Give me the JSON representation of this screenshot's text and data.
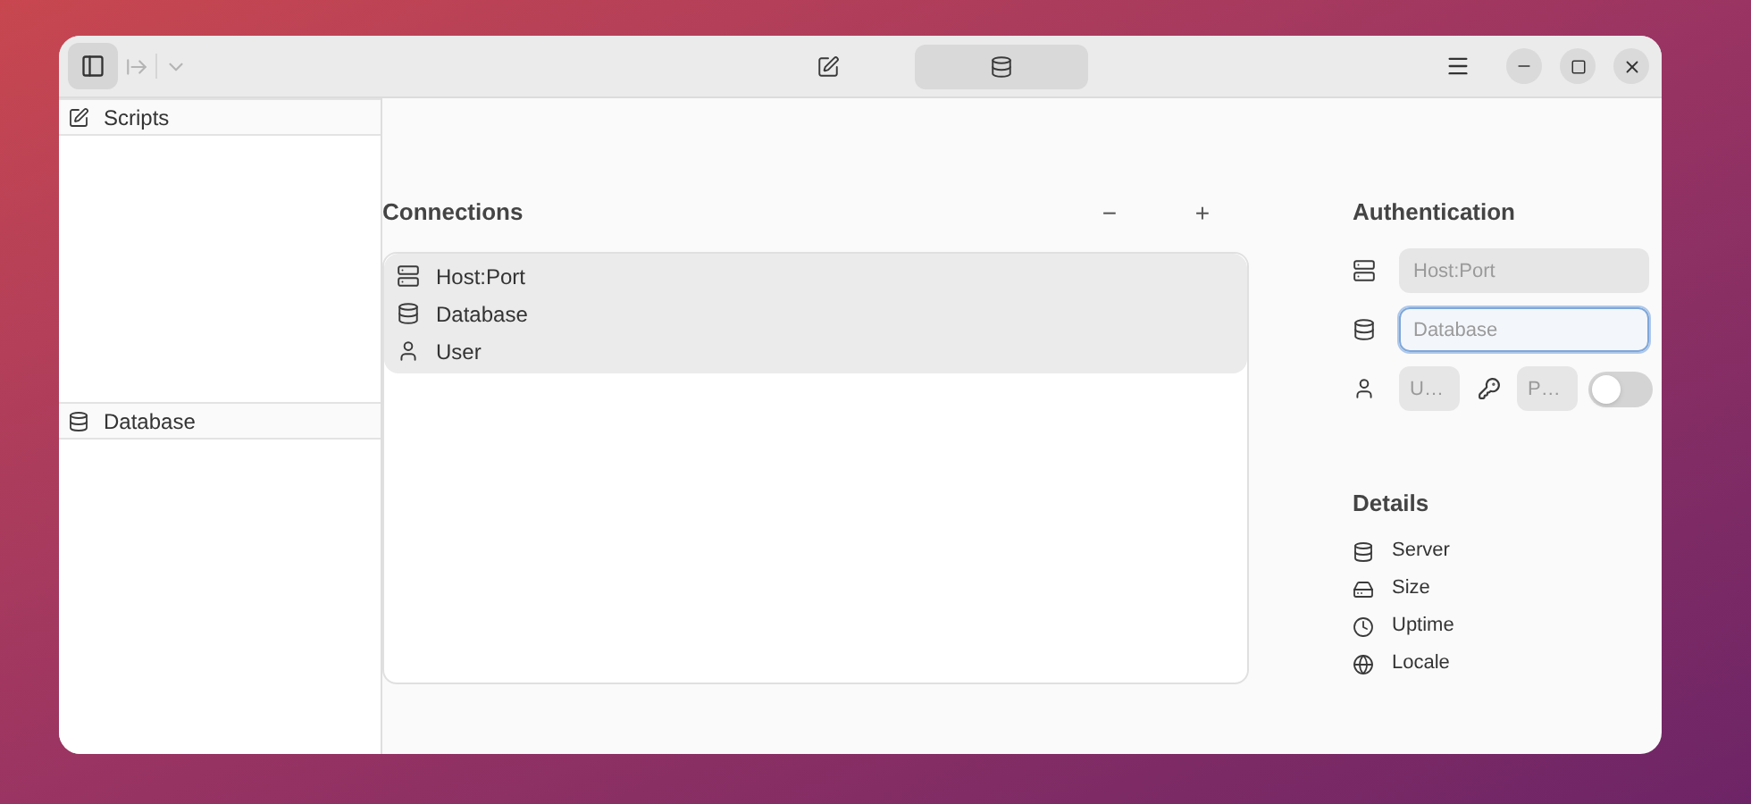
{
  "header": {
    "sidebar_toggle": {
      "selected": true
    },
    "view_tabs": [
      {
        "kind": "edit",
        "selected": false
      },
      {
        "kind": "database",
        "selected": true
      }
    ]
  },
  "sidebar": {
    "sections": [
      {
        "kind": "edit",
        "label": "Scripts"
      },
      {
        "kind": "database",
        "label": "Database"
      }
    ]
  },
  "connections": {
    "title": "Connections",
    "remove_label": "−",
    "add_label": "+",
    "items": [
      {
        "kind": "server",
        "label": "Host:Port"
      },
      {
        "kind": "database",
        "label": "Database"
      },
      {
        "kind": "user",
        "label": "User"
      }
    ]
  },
  "authentication": {
    "title": "Authentication",
    "fields": [
      {
        "kind": "server",
        "placeholder": "Host:Port",
        "focused": false
      },
      {
        "kind": "database",
        "placeholder": "Database",
        "focused": true
      }
    ],
    "user_placeholder": "U…",
    "password_placeholder": "P…",
    "toggle": {
      "on": false
    }
  },
  "details": {
    "title": "Details",
    "items": [
      {
        "kind": "database",
        "label": "Server"
      },
      {
        "kind": "disk",
        "label": "Size"
      },
      {
        "kind": "clock",
        "label": "Uptime"
      },
      {
        "kind": "globe",
        "label": "Locale"
      }
    ]
  }
}
